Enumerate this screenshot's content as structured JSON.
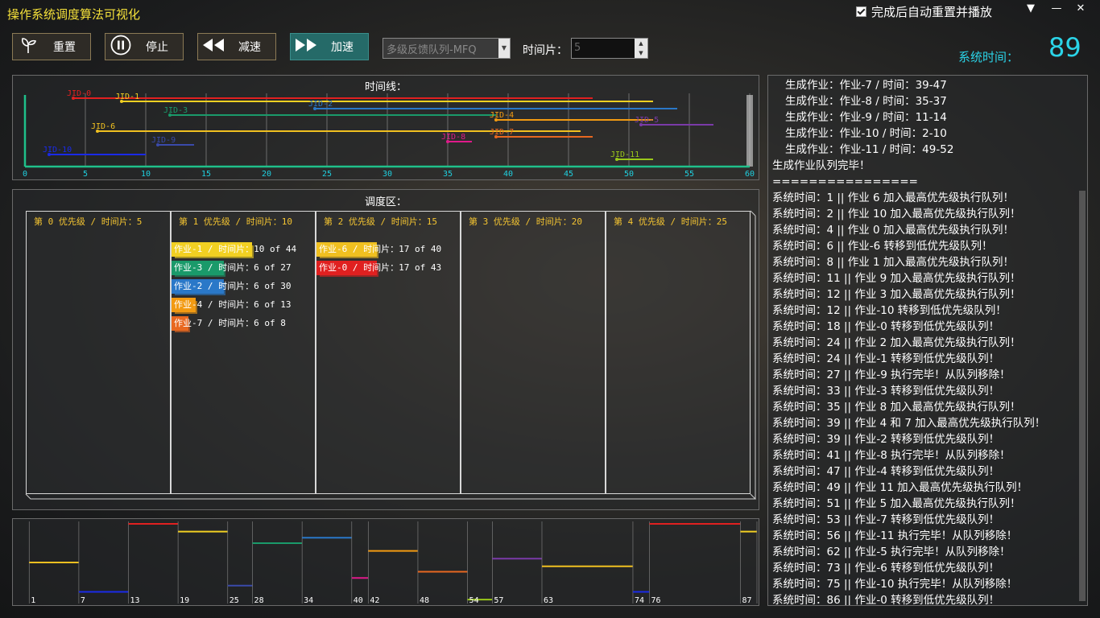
{
  "app": {
    "title": "操作系统调度算法可视化",
    "autoreset_label": "完成后自动重置并播放",
    "win_buttons": [
      "▼",
      "—",
      "✕"
    ]
  },
  "toolbar": {
    "reset": "重置",
    "stop": "停止",
    "slower": "减速",
    "faster": "加速",
    "algorithm": "多级反馈队列-MFQ",
    "slice_label": "时间片：",
    "slice_value": "5",
    "systime_label": "系统时间：",
    "systime_value": "89"
  },
  "timeline": {
    "title": "时间线：",
    "xlim": [
      0,
      60
    ],
    "ticks": [
      "0",
      "5",
      "10",
      "15",
      "20",
      "25",
      "30",
      "35",
      "40",
      "45",
      "50",
      "55",
      "60"
    ],
    "jobs": [
      {
        "label": "JID-0",
        "color": "#e02020",
        "start": 4,
        "end": 47
      },
      {
        "label": "JID-1",
        "color": "#f2d022",
        "start": 8,
        "end": 52
      },
      {
        "label": "JID-2",
        "color": "#2a78c8",
        "start": 24,
        "end": 54
      },
      {
        "label": "JID-3",
        "color": "#1a9a6a",
        "start": 12,
        "end": 39
      },
      {
        "label": "JID-4",
        "color": "#f29a12",
        "start": 39,
        "end": 52
      },
      {
        "label": "JID-5",
        "color": "#7a3aa8",
        "start": 51,
        "end": 57
      },
      {
        "label": "JID-6",
        "color": "#f0c020",
        "start": 6,
        "end": 46
      },
      {
        "label": "JID-7",
        "color": "#e86820",
        "start": 39,
        "end": 47
      },
      {
        "label": "JID-8",
        "color": "#e01a8a",
        "start": 35,
        "end": 37
      },
      {
        "label": "JID-9",
        "color": "#3a4aaa",
        "start": 11,
        "end": 14
      },
      {
        "label": "JID-10",
        "color": "#1a2ae8",
        "start": 2,
        "end": 10
      },
      {
        "label": "JID-11",
        "color": "#9ac81a",
        "start": 49,
        "end": 52
      }
    ]
  },
  "schedule": {
    "title": "调度区：",
    "queues": [
      {
        "header": "第 0 优先级 / 时间片：5",
        "jobs": []
      },
      {
        "header": "第 1 优先级 / 时间片：10",
        "jobs": [
          {
            "text": "作业-1 / 时间片：10 of 44",
            "color": "#f2d022",
            "fill": 1.0
          },
          {
            "text": "作业-3 / 时间片：6 of 27",
            "color": "#1a9a6a",
            "fill": 0.6
          },
          {
            "text": "作业-2 / 时间片：6 of 30",
            "color": "#2a78c8",
            "fill": 0.6
          },
          {
            "text": "作业-4 / 时间片：6 of 13",
            "color": "#f29a12",
            "fill": 0.2
          },
          {
            "text": "作业-7 / 时间片：6 of 8",
            "color": "#e86820",
            "fill": 0.1
          }
        ]
      },
      {
        "header": "第 2 优先级 / 时间片：15",
        "jobs": [
          {
            "text": "作业-6 / 时间片：17 of 40",
            "color": "#f0c020",
            "fill": 0.72
          },
          {
            "text": "作业-0 / 时间片：17 of 43",
            "color": "#e02020",
            "fill": 0.72
          }
        ]
      },
      {
        "header": "第 3 优先级 / 时间片：20",
        "jobs": []
      },
      {
        "header": "第 4 优先级 / 时间片：25",
        "jobs": []
      }
    ]
  },
  "gantt": {
    "xlim": [
      0,
      89
    ],
    "segments": [
      {
        "from": 1,
        "to": 7,
        "color": "#f0c020",
        "level": 0.5
      },
      {
        "from": 7,
        "to": 13,
        "color": "#1a2ae8",
        "level": 0.12
      },
      {
        "from": 13,
        "to": 19,
        "color": "#e02020",
        "level": 1.0
      },
      {
        "from": 19,
        "to": 25,
        "color": "#f2d022",
        "level": 0.9
      },
      {
        "from": 25,
        "to": 28,
        "color": "#3a4aaa",
        "level": 0.2
      },
      {
        "from": 28,
        "to": 34,
        "color": "#1a9a6a",
        "level": 0.75
      },
      {
        "from": 34,
        "to": 40,
        "color": "#2a78c8",
        "level": 0.82
      },
      {
        "from": 40,
        "to": 42,
        "color": "#e01a8a",
        "level": 0.3
      },
      {
        "from": 42,
        "to": 48,
        "color": "#f29a12",
        "level": 0.65
      },
      {
        "from": 48,
        "to": 54,
        "color": "#e86820",
        "level": 0.38
      },
      {
        "from": 54,
        "to": 57,
        "color": "#9ac81a",
        "level": 0.02
      },
      {
        "from": 57,
        "to": 63,
        "color": "#7a3aa8",
        "level": 0.55
      },
      {
        "from": 63,
        "to": 74,
        "color": "#f0c020",
        "level": 0.45
      },
      {
        "from": 74,
        "to": 76,
        "color": "#1a2ae8",
        "level": 0.12
      },
      {
        "from": 76,
        "to": 87,
        "color": "#e02020",
        "level": 1.0
      },
      {
        "from": 87,
        "to": 89,
        "color": "#f2d022",
        "level": 0.9
      }
    ],
    "ticks": [
      "1",
      "7",
      "13",
      "19",
      "25",
      "28",
      "34",
      "40",
      "42",
      "48",
      "54",
      "57",
      "63",
      "74",
      "76",
      "87"
    ]
  },
  "log": {
    "lines": [
      {
        "text": "生成作业：作业-7 / 时间：39-47",
        "indent": true
      },
      {
        "text": "生成作业：作业-8 / 时间：35-37",
        "indent": true
      },
      {
        "text": "生成作业：作业-9 / 时间：11-14",
        "indent": true
      },
      {
        "text": "生成作业：作业-10 / 时间：2-10",
        "indent": true
      },
      {
        "text": "生成作业：作业-11 / 时间：49-52",
        "indent": true
      },
      {
        "text": "生成作业队列完毕！",
        "indent": false
      },
      {
        "text": "================",
        "indent": false
      },
      {
        "text": "系统时间：1 || 作业 6 加入最高优先级执行队列！",
        "indent": false
      },
      {
        "text": "系统时间：2 || 作业 10 加入最高优先级执行队列！",
        "indent": false
      },
      {
        "text": "系统时间：4 || 作业 0 加入最高优先级执行队列！",
        "indent": false
      },
      {
        "text": "系统时间：6 || 作业-6 转移到低优先级队列！",
        "indent": false
      },
      {
        "text": "系统时间：8 || 作业 1 加入最高优先级执行队列！",
        "indent": false
      },
      {
        "text": "系统时间：11 || 作业 9 加入最高优先级执行队列！",
        "indent": false
      },
      {
        "text": "系统时间：12 || 作业 3 加入最高优先级执行队列！",
        "indent": false
      },
      {
        "text": "系统时间：12 || 作业-10 转移到低优先级队列！",
        "indent": false
      },
      {
        "text": "系统时间：18 || 作业-0 转移到低优先级队列！",
        "indent": false
      },
      {
        "text": "系统时间：24 || 作业 2 加入最高优先级执行队列！",
        "indent": false
      },
      {
        "text": "系统时间：24 || 作业-1 转移到低优先级队列！",
        "indent": false
      },
      {
        "text": "系统时间：27 || 作业-9 执行完毕！从队列移除！",
        "indent": false
      },
      {
        "text": "系统时间：33 || 作业-3 转移到低优先级队列！",
        "indent": false
      },
      {
        "text": "系统时间：35 || 作业 8 加入最高优先级执行队列！",
        "indent": false
      },
      {
        "text": "系统时间：39 || 作业 4 和 7 加入最高优先级执行队列！",
        "indent": false
      },
      {
        "text": "系统时间：39 || 作业-2 转移到低优先级队列！",
        "indent": false
      },
      {
        "text": "系统时间：41 || 作业-8 执行完毕！从队列移除！",
        "indent": false
      },
      {
        "text": "系统时间：47 || 作业-4 转移到低优先级队列！",
        "indent": false
      },
      {
        "text": "系统时间：49 || 作业 11 加入最高优先级执行队列！",
        "indent": false
      },
      {
        "text": "系统时间：51 || 作业 5 加入最高优先级执行队列！",
        "indent": false
      },
      {
        "text": "系统时间：53 || 作业-7 转移到低优先级队列！",
        "indent": false
      },
      {
        "text": "系统时间：56 || 作业-11 执行完毕！从队列移除！",
        "indent": false
      },
      {
        "text": "系统时间：62 || 作业-5 执行完毕！从队列移除！",
        "indent": false
      },
      {
        "text": "系统时间：73 || 作业-6 转移到低优先级队列！",
        "indent": false
      },
      {
        "text": "系统时间：75 || 作业-10 执行完毕！从队列移除！",
        "indent": false
      },
      {
        "text": "系统时间：86 || 作业-0 转移到低优先级队列！",
        "indent": false
      }
    ]
  }
}
